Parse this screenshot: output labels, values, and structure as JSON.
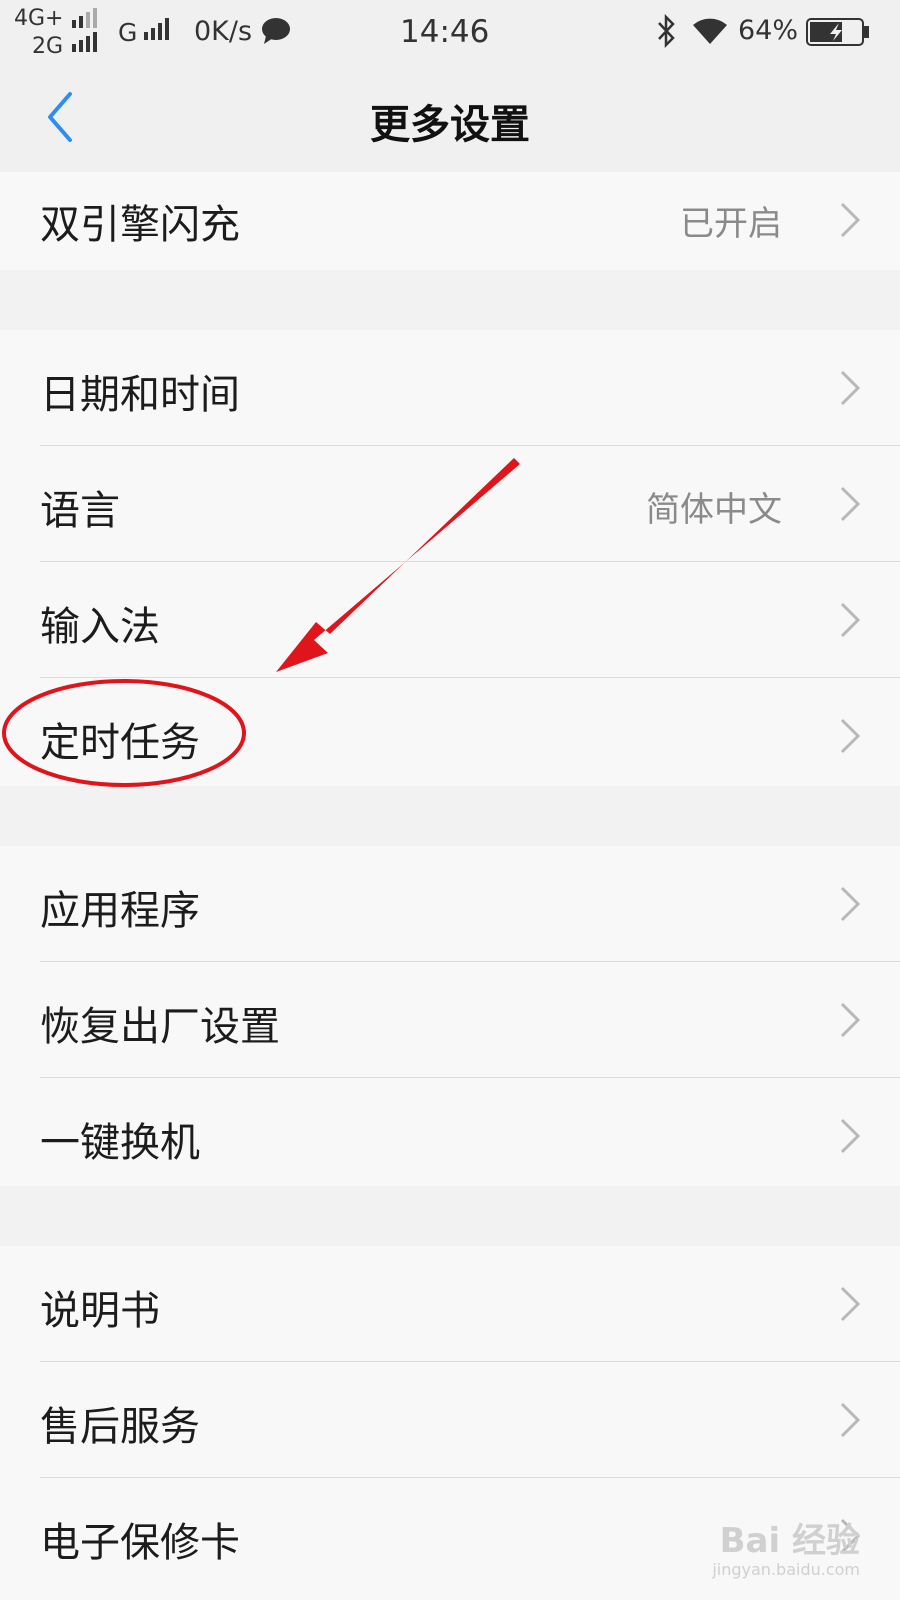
{
  "status_bar": {
    "network_primary": "4G+",
    "network_secondary": "2G",
    "network_tertiary": "G",
    "speed": "0K/s",
    "time": "14:46",
    "battery_percent": "64%",
    "battery_level": 0.64,
    "icons": [
      "message-icon",
      "bluetooth-icon",
      "wifi-icon",
      "battery-icon"
    ]
  },
  "nav": {
    "title": "更多设置",
    "back_icon": "chevron-left-icon",
    "accent_color": "#2b8ef0"
  },
  "groups": [
    {
      "items": [
        {
          "label": "双引擎闪充",
          "value": "已开启"
        }
      ]
    },
    {
      "items": [
        {
          "label": "日期和时间",
          "value": ""
        },
        {
          "label": "语言",
          "value": "简体中文"
        },
        {
          "label": "输入法",
          "value": ""
        },
        {
          "label": "定时任务",
          "value": ""
        }
      ]
    },
    {
      "items": [
        {
          "label": "应用程序",
          "value": ""
        },
        {
          "label": "恢复出厂设置",
          "value": ""
        },
        {
          "label": "一键换机",
          "value": ""
        }
      ]
    },
    {
      "items": [
        {
          "label": "说明书",
          "value": ""
        },
        {
          "label": "售后服务",
          "value": ""
        },
        {
          "label": "电子保修卡",
          "value": ""
        }
      ]
    }
  ],
  "annotation": {
    "color": "#e0141b",
    "shapes": [
      "arrow",
      "ellipse"
    ],
    "highlighted_item": "定时任务"
  },
  "watermark": {
    "brand": "Bai 经验",
    "url": "jingyan.baidu.com"
  }
}
